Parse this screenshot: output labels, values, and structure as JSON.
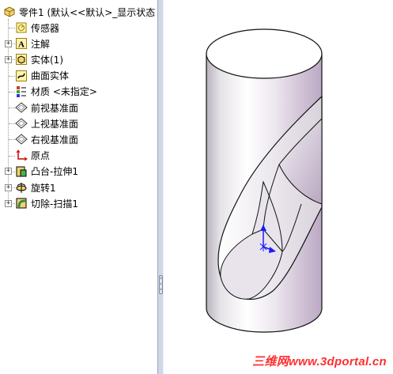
{
  "feature_tree": {
    "root_label": "零件1  (默认<<默认>_显示状态",
    "items": [
      {
        "label": "传感器",
        "icon": "sensor-icon",
        "expandable": false
      },
      {
        "label": "注解",
        "icon": "annotation-icon",
        "expandable": true
      },
      {
        "label": "实体(1)",
        "icon": "solid-body-icon",
        "expandable": true
      },
      {
        "label": "曲面实体",
        "icon": "surface-body-icon",
        "expandable": false
      },
      {
        "label": "材质 <未指定>",
        "icon": "material-icon",
        "expandable": false
      },
      {
        "label": "前视基准面",
        "icon": "plane-icon",
        "expandable": false
      },
      {
        "label": "上视基准面",
        "icon": "plane-icon",
        "expandable": false
      },
      {
        "label": "右视基准面",
        "icon": "plane-icon",
        "expandable": false
      },
      {
        "label": "原点",
        "icon": "origin-icon",
        "expandable": false
      },
      {
        "label": "凸台-拉伸1",
        "icon": "boss-extrude-icon",
        "expandable": true
      },
      {
        "label": "旋转1",
        "icon": "revolve-icon",
        "expandable": true
      },
      {
        "label": "切除-扫描1",
        "icon": "cut-sweep-icon",
        "expandable": true
      }
    ]
  },
  "watermark": "三维网www.3dportal.cn",
  "colors": {
    "panel_bg": "#ffffff",
    "splitter": "#cfd8e6",
    "model_shade": "#c9b8cf",
    "watermark": "#ff2f2f",
    "triad_y": "#1a1aff"
  }
}
